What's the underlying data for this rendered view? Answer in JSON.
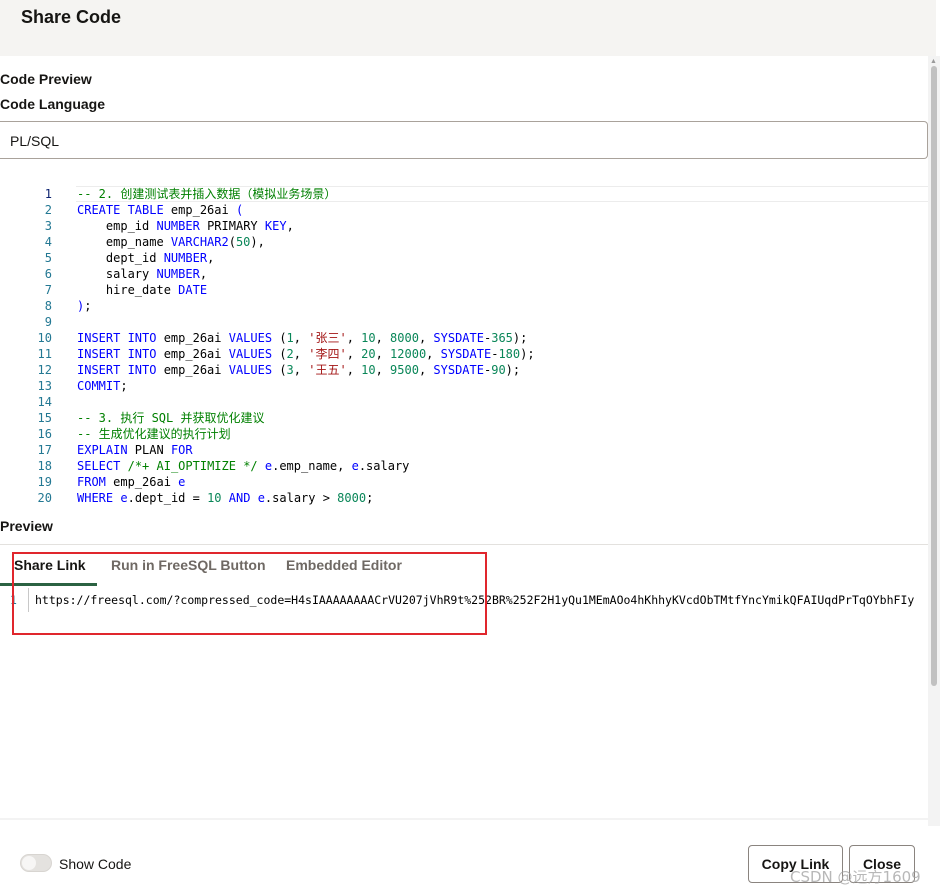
{
  "dialog": {
    "title": "Share Code"
  },
  "labels": {
    "code_preview": "Code Preview",
    "code_language": "Code Language",
    "preview": "Preview"
  },
  "language_select": {
    "value": "PL/SQL"
  },
  "code_lines": [
    {
      "n": "1",
      "html": "<span class=\"cm\">-- 2. 创建测试表并插入数据（模拟业务场景）</span>"
    },
    {
      "n": "2",
      "html": "<span class=\"kw\">CREATE TABLE</span> emp_26ai <span class=\"kw\">(</span>"
    },
    {
      "n": "3",
      "html": "    emp_id <span class=\"kw\">NUMBER</span> PRIMARY <span class=\"kw\">KEY</span>,"
    },
    {
      "n": "4",
      "html": "    emp_name <span class=\"kw\">VARCHAR2</span>(<span class=\"nm\">50</span>),"
    },
    {
      "n": "5",
      "html": "    dept_id <span class=\"kw\">NUMBER</span>,"
    },
    {
      "n": "6",
      "html": "    salary <span class=\"kw\">NUMBER</span>,"
    },
    {
      "n": "7",
      "html": "    hire_date <span class=\"kw\">DATE</span>"
    },
    {
      "n": "8",
      "html": "<span class=\"kw\">)</span>;"
    },
    {
      "n": "9",
      "html": ""
    },
    {
      "n": "10",
      "html": "<span class=\"kw\">INSERT INTO</span> emp_26ai <span class=\"kw\">VALUES</span> (<span class=\"nm\">1</span>, <span class=\"st\">'张三'</span>, <span class=\"nm\">10</span>, <span class=\"nm\">8000</span>, <span class=\"kw\">SYSDATE</span>-<span class=\"nm\">365</span>);"
    },
    {
      "n": "11",
      "html": "<span class=\"kw\">INSERT INTO</span> emp_26ai <span class=\"kw\">VALUES</span> (<span class=\"nm\">2</span>, <span class=\"st\">'李四'</span>, <span class=\"nm\">20</span>, <span class=\"nm\">12000</span>, <span class=\"kw\">SYSDATE</span>-<span class=\"nm\">180</span>);"
    },
    {
      "n": "12",
      "html": "<span class=\"kw\">INSERT INTO</span> emp_26ai <span class=\"kw\">VALUES</span> (<span class=\"nm\">3</span>, <span class=\"st\">'王五'</span>, <span class=\"nm\">10</span>, <span class=\"nm\">9500</span>, <span class=\"kw\">SYSDATE</span>-<span class=\"nm\">90</span>);"
    },
    {
      "n": "13",
      "html": "<span class=\"kw\">COMMIT</span>;"
    },
    {
      "n": "14",
      "html": ""
    },
    {
      "n": "15",
      "html": "<span class=\"cm\">-- 3. 执行 SQL 并获取优化建议</span>"
    },
    {
      "n": "16",
      "html": "<span class=\"cm\">-- 生成优化建议的执行计划</span>"
    },
    {
      "n": "17",
      "html": "<span class=\"kw\">EXPLAIN</span> PLAN <span class=\"kw\">FOR</span>"
    },
    {
      "n": "18",
      "html": "<span class=\"kw\">SELECT</span> <span class=\"cm\">/*+ AI_OPTIMIZE */</span> <span class=\"kw\">e</span>.emp_name, <span class=\"kw\">e</span>.salary"
    },
    {
      "n": "19",
      "html": "<span class=\"kw\">FROM</span> emp_26ai <span class=\"kw\">e</span>"
    },
    {
      "n": "20",
      "html": "<span class=\"kw\">WHERE</span> <span class=\"kw\">e</span>.dept_id = <span class=\"nm\">10</span> <span class=\"kw\">AND</span> <span class=\"kw\">e</span>.salary &gt; <span class=\"nm\">8000</span>;"
    }
  ],
  "tabs": [
    {
      "label": "Share Link",
      "selected": true
    },
    {
      "label": "Run in FreeSQL Button",
      "selected": false
    },
    {
      "label": "Embedded Editor",
      "selected": false
    }
  ],
  "share_link": {
    "line_number": "1",
    "url": "https://freesql.com/?compressed_code=H4sIAAAAAAAACrVU207jVhR9t%252BR%252F2H1yQu1MEmAOo4hKhhyKVcdObTMtfYncYmikQFAIUqdPrTqOYbhFIy"
  },
  "footer": {
    "toggle_label": "Show Code",
    "toggle_on": false,
    "copy_link": "Copy Link",
    "close": "Close"
  },
  "watermark": "CSDN @远方1609"
}
